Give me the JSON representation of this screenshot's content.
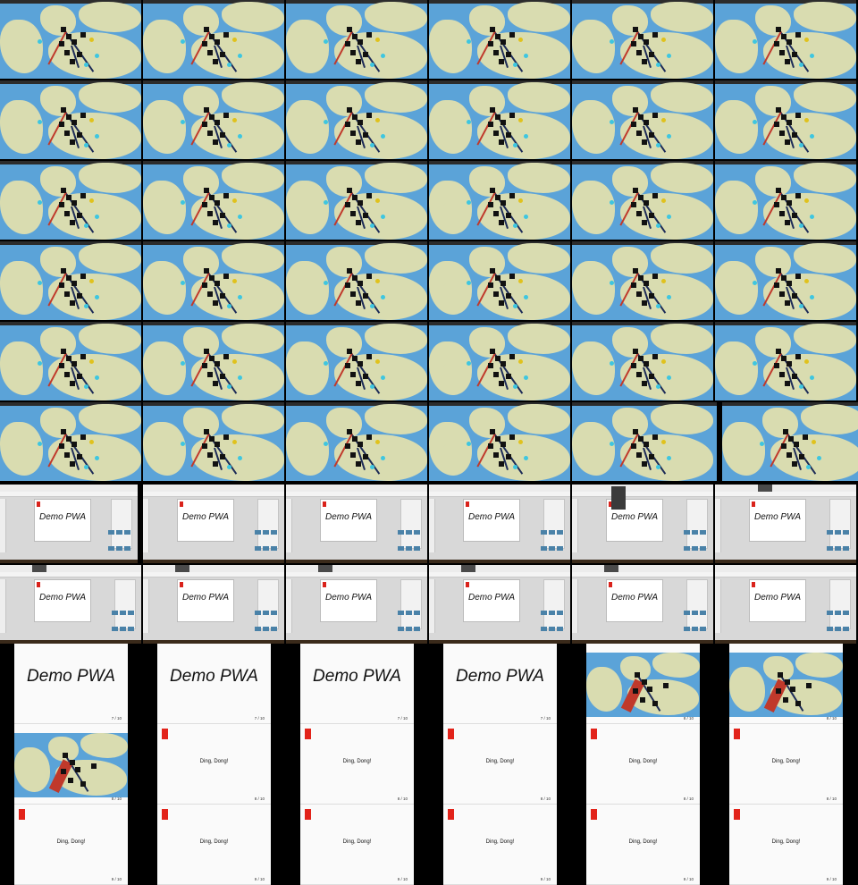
{
  "editor_slide_title": "Demo PWA",
  "slides": {
    "demo_title": "Demo PWA",
    "ding_text": "Ding, Dong!",
    "page_7": "7 / 10",
    "page_8": "8 / 10",
    "page_9": "9 / 10"
  },
  "colors": {
    "sea": "#5ba3d8",
    "land": "#d9dcb0",
    "route": "#1d2b57",
    "slide_accent": "#e2231a",
    "editor_bg": "#d8d8d8",
    "tile": "#4a82a8"
  },
  "icons": [
    "map-marker-icon",
    "route-line-icon",
    "slide-accent-icon",
    "tile-icon"
  ]
}
